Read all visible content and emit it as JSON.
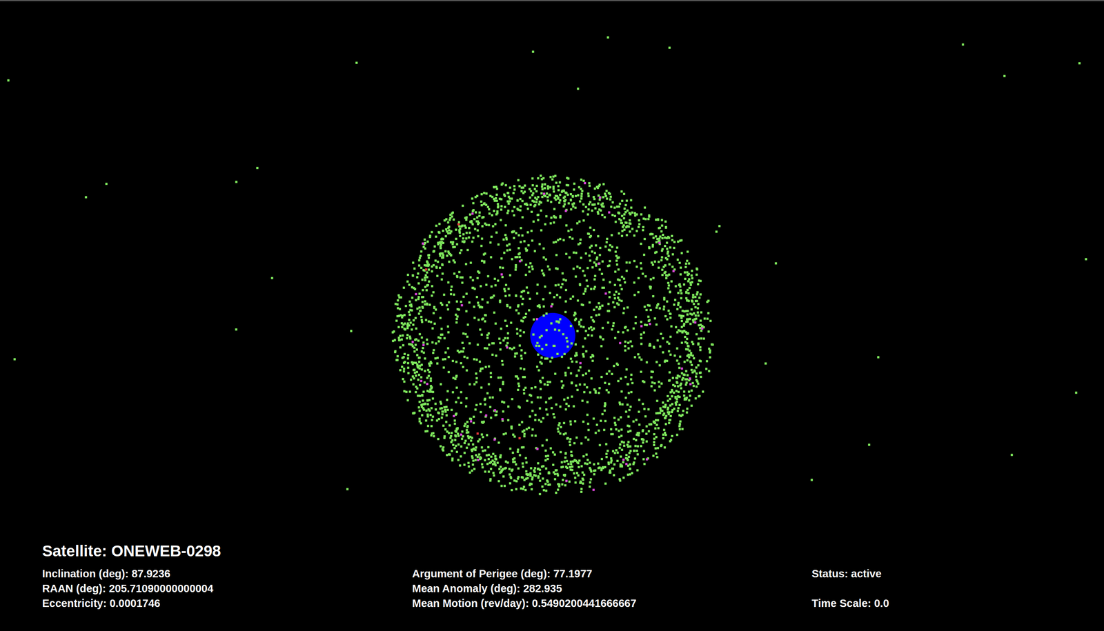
{
  "satellite": {
    "title": "Satellite: ONEWEB-0298"
  },
  "orbit_left": [
    "Inclination (deg): 87.9236",
    "RAAN (deg): 205.71090000000004",
    "Eccentricity: 0.0001746"
  ],
  "orbit_middle": [
    "Argument of Perigee (deg): 77.1977",
    "Mean Anomaly (deg): 282.935",
    "Mean Motion (rev/day): 0.5490200441666667"
  ],
  "status_panel": [
    "Status: active",
    "Time Scale: 0.0"
  ],
  "object_groups": [
    {
      "kind": "cloud",
      "color": "#7ee65c",
      "count": 2500
    },
    {
      "kind": "far",
      "color": "#7ee65c",
      "count": 28
    },
    {
      "kind": "cloud",
      "color": "#d846d8",
      "count": 45
    },
    {
      "kind": "cloud",
      "color": "#e23a3a",
      "count": 4
    }
  ]
}
